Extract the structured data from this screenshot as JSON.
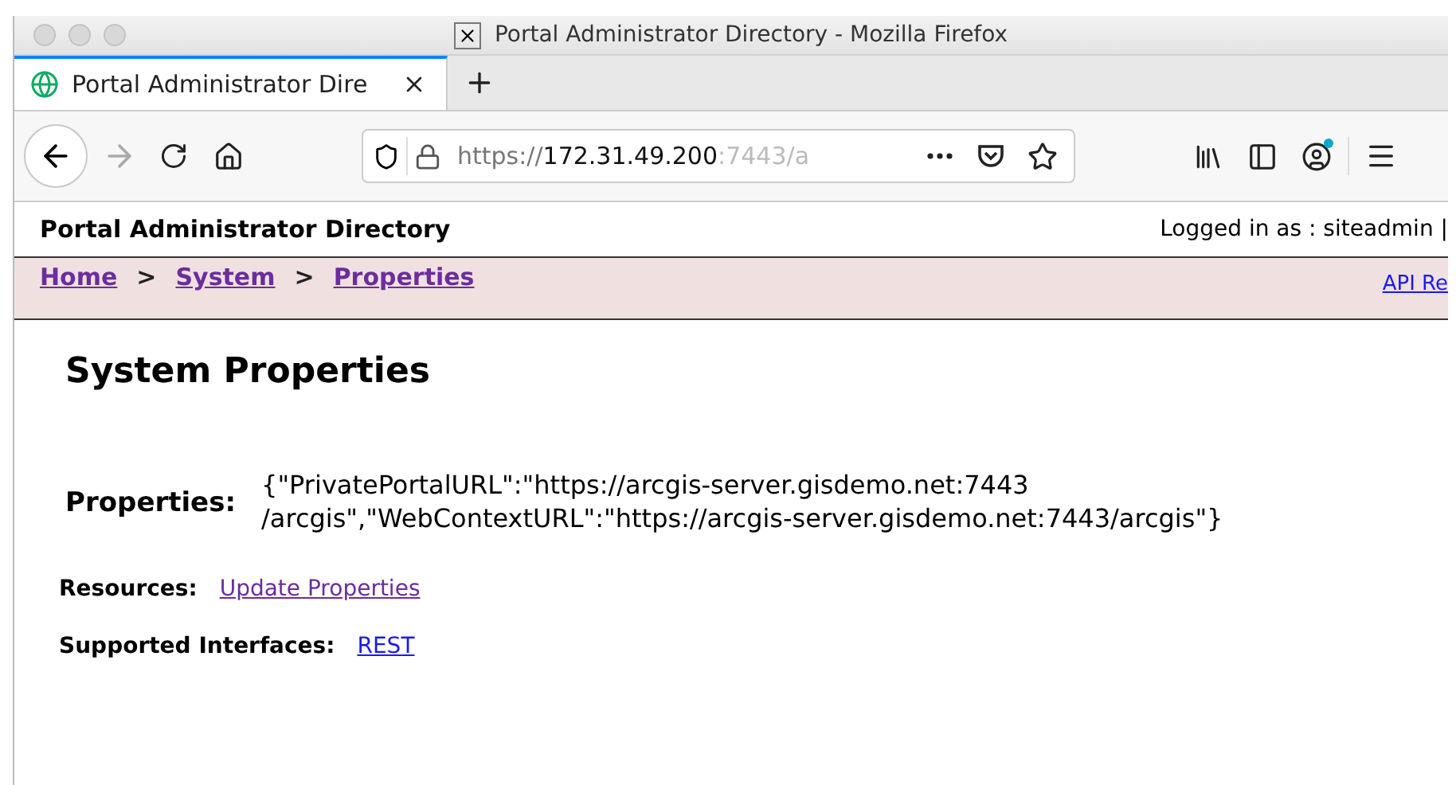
{
  "window": {
    "title": "Portal Administrator Directory - Mozilla Firefox"
  },
  "tabs": [
    {
      "label": "Portal Administrator Dire",
      "selected": true
    }
  ],
  "address_bar": {
    "scheme": "https://",
    "host": "172.31.49.200",
    "rest": ":7443/a"
  },
  "page": {
    "header": {
      "title": "Portal Administrator Directory",
      "user": "Logged in as : siteadmin |"
    },
    "breadcrumbs": [
      {
        "label": "Home",
        "visited": true
      },
      {
        "label": ">",
        "kind": "separator"
      },
      {
        "label": "System",
        "visited": true
      },
      {
        "label": ">",
        "kind": "separator"
      },
      {
        "label": "Properties",
        "visited": true
      }
    ],
    "api_link": {
      "label": "API Re",
      "visited": false
    },
    "heading": "System Properties",
    "properties": {
      "label": "Properties:",
      "value": "{\"PrivatePortalURL\":\"https://arcgis-server.gisdemo.net:7443 /arcgis\",\"WebContextURL\":\"https://arcgis-server.gisdemo.net:7443/arcgis\"}"
    },
    "rows": [
      {
        "label": "Resources:",
        "link": {
          "label": "Update Properties",
          "visited": true
        }
      },
      {
        "label": "Supported Interfaces:",
        "link": {
          "label": "REST",
          "visited": false
        }
      }
    ]
  }
}
